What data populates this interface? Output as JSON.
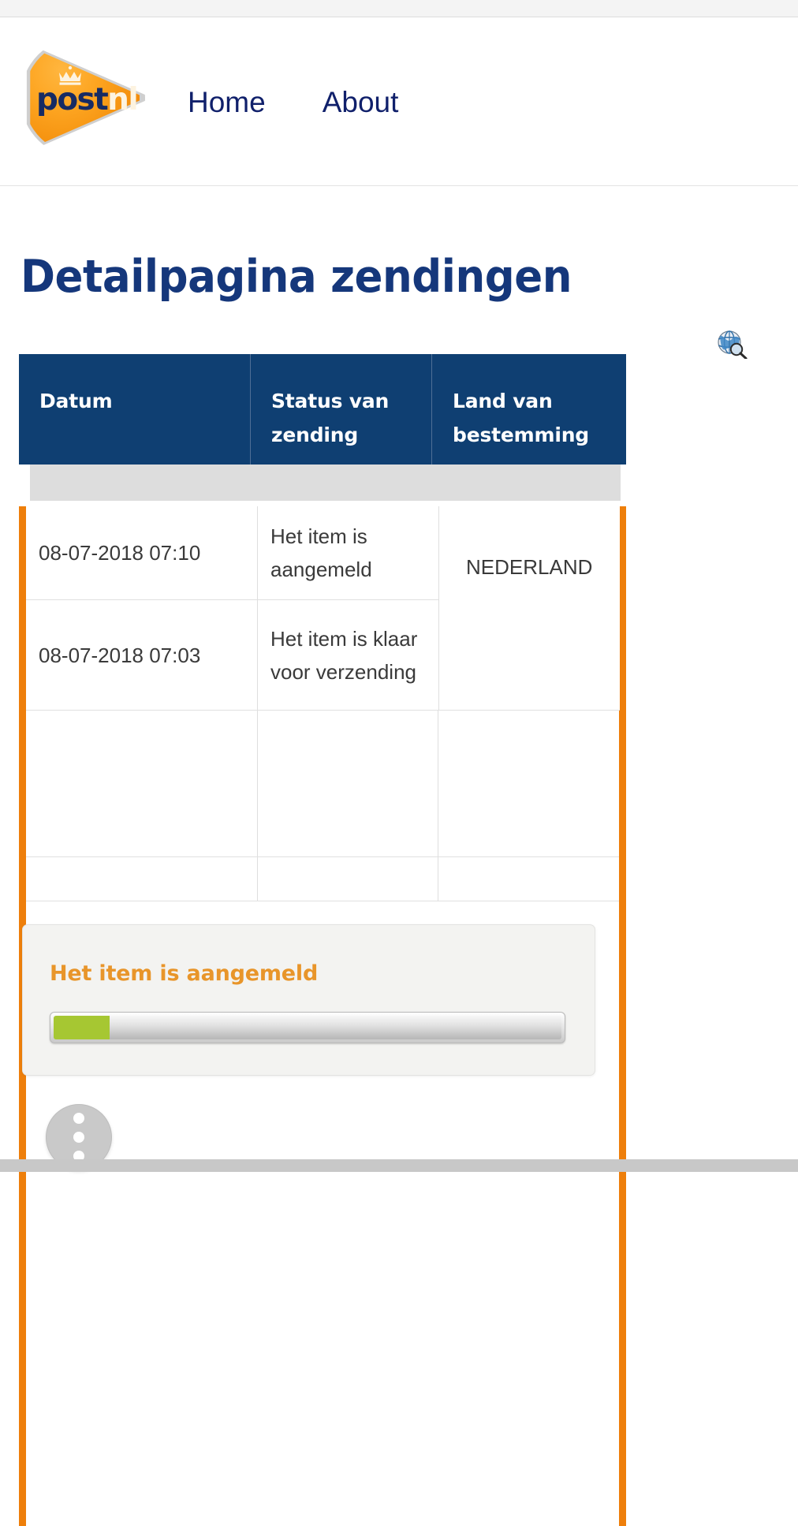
{
  "brand": {
    "logo_text_primary": "post",
    "logo_text_secondary": "nl",
    "logo_icon": "postnl-logo-icon",
    "crown_icon": "crown-icon"
  },
  "nav": {
    "items": [
      {
        "label": "Home"
      },
      {
        "label": "About"
      }
    ]
  },
  "page": {
    "title": "Detailpagina zendingen",
    "globe_search_icon": "globe-search-icon"
  },
  "table": {
    "columns": [
      {
        "label": "Datum"
      },
      {
        "label": "Status van zending"
      },
      {
        "label": "Land van bestemming"
      }
    ],
    "rows": [
      {
        "datum": "08-07-2018 07:10",
        "status": "Het item is aangemeld",
        "land": "NEDERLAND"
      },
      {
        "datum": "08-07-2018 07:03",
        "status": "Het item is klaar voor verzending",
        "land": ""
      },
      {
        "datum": "",
        "status": "",
        "land": ""
      },
      {
        "datum": "",
        "status": "",
        "land": ""
      }
    ]
  },
  "status_card": {
    "title": "Het item is aangemeld",
    "progress_percent": 11
  },
  "fab": {
    "icon": "kebab-menu-icon"
  },
  "colors": {
    "navy": "#0f3f72",
    "orange": "#ee7f0b",
    "title_blue": "#15377b",
    "progress_green": "#a6c732",
    "status_orange": "#e8952a",
    "gray_band": "#dddddd"
  }
}
